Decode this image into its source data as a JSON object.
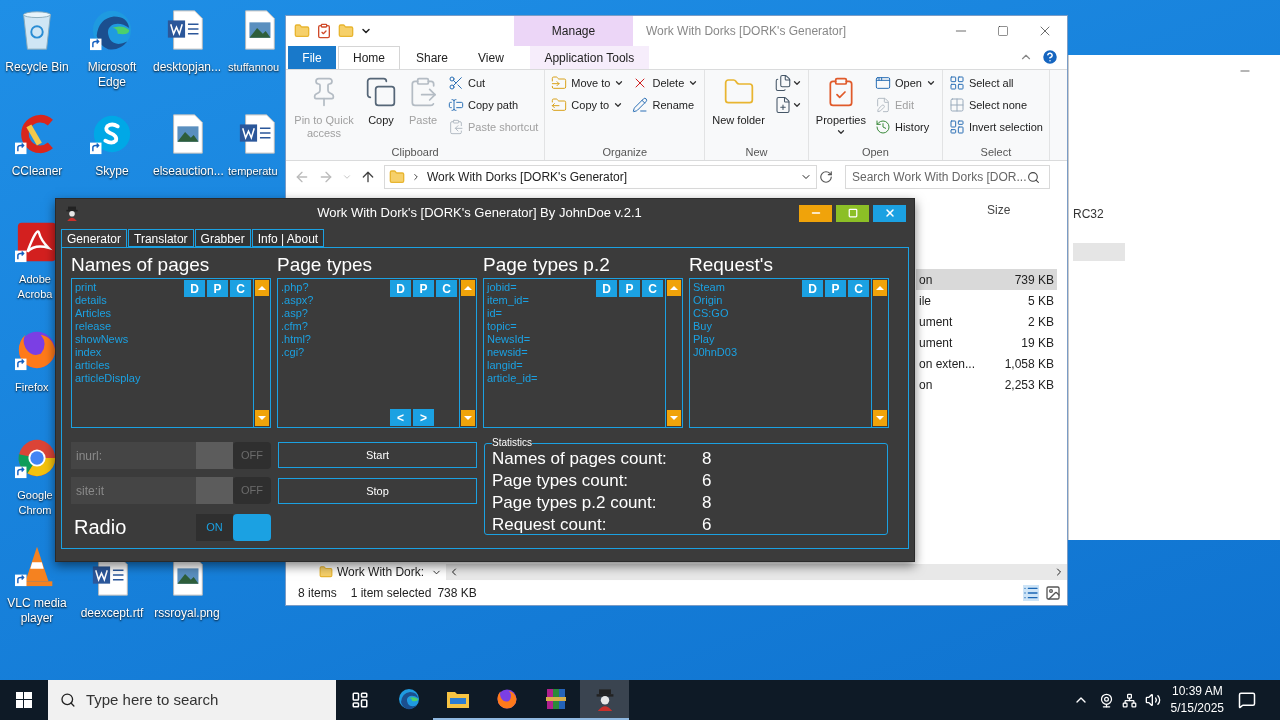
{
  "desktop_icons": [
    {
      "label": "Recycle Bin",
      "kind": "recycle",
      "shortcut": false
    },
    {
      "label": "CCleaner",
      "kind": "cleaner",
      "shortcut": true
    },
    {
      "label": "Adobe Acroba",
      "kind": "pdf",
      "shortcut": true
    },
    {
      "label": "Firefox",
      "kind": "firefox",
      "shortcut": true
    },
    {
      "label": "Google Chrom",
      "kind": "chrome",
      "shortcut": true
    },
    {
      "label": "VLC media player",
      "kind": "vlc",
      "shortcut": true
    },
    {
      "label": "Microsoft Edge",
      "kind": "edge",
      "shortcut": true
    },
    {
      "label": "Skype",
      "kind": "skype",
      "shortcut": true
    },
    {
      "label": "deexcept.rtf",
      "kind": "word",
      "shortcut": false
    },
    {
      "label": "desktopjan...",
      "kind": "word",
      "shortcut": false
    },
    {
      "label": "elseauction...",
      "kind": "image",
      "shortcut": false
    },
    {
      "label": "rssroyal.png",
      "kind": "image",
      "shortcut": false
    },
    {
      "label": "stuffannou",
      "kind": "image",
      "shortcut": false
    },
    {
      "label": "temperatu",
      "kind": "word",
      "shortcut": false
    }
  ],
  "back_window": {
    "column_header": "RC32"
  },
  "explorer": {
    "context_label": "Manage",
    "title": "Work With Dorks [DORK's Generator]",
    "tabs": [
      {
        "label": "File",
        "kind": "file",
        "selected": false
      },
      {
        "label": "Home",
        "kind": "normal",
        "selected": true
      },
      {
        "label": "Share",
        "kind": "normal",
        "selected": false
      },
      {
        "label": "View",
        "kind": "normal",
        "selected": false
      },
      {
        "label": "Application Tools",
        "kind": "context",
        "selected": false
      }
    ],
    "ribbon": [
      {
        "label": "Clipboard",
        "columns": [
          [
            {
              "label": "Pin to Quick access",
              "kind": "large",
              "disabled": true,
              "dropdown": false
            }
          ],
          [
            {
              "label": "Copy",
              "kind": "large",
              "disabled": false,
              "dropdown": false
            }
          ],
          [
            {
              "label": "Paste",
              "kind": "large",
              "disabled": true,
              "dropdown": false
            }
          ],
          [
            {
              "label": "Cut",
              "kind": "small",
              "disabled": false,
              "dropdown": false
            },
            {
              "label": "Copy path",
              "kind": "small",
              "disabled": false,
              "dropdown": false
            },
            {
              "label": "Paste shortcut",
              "kind": "small",
              "disabled": true,
              "dropdown": false
            }
          ]
        ]
      },
      {
        "label": "Organize",
        "columns": [
          [
            {
              "label": "Move to",
              "kind": "small",
              "disabled": false,
              "dropdown": true
            },
            {
              "label": "Copy to",
              "kind": "small",
              "disabled": false,
              "dropdown": true
            }
          ],
          [
            {
              "label": "Delete",
              "kind": "small",
              "disabled": false,
              "dropdown": true
            },
            {
              "label": "Rename",
              "kind": "small",
              "disabled": false,
              "dropdown": false
            }
          ]
        ]
      },
      {
        "label": "New",
        "columns": [
          [
            {
              "label": "New folder",
              "kind": "large",
              "disabled": false,
              "dropdown": false
            }
          ],
          [
            {
              "kind": "icon",
              "dropdown": true
            },
            {
              "kind": "icon",
              "dropdown": true
            }
          ]
        ]
      },
      {
        "label": "Open",
        "columns": [
          [
            {
              "label": "Properties",
              "kind": "large",
              "disabled": false,
              "dropdown": true
            }
          ],
          [
            {
              "label": "Open",
              "kind": "small",
              "disabled": false,
              "dropdown": true
            },
            {
              "label": "Edit",
              "kind": "small",
              "disabled": true,
              "dropdown": false
            },
            {
              "label": "History",
              "kind": "small",
              "disabled": false,
              "dropdown": false
            }
          ]
        ]
      },
      {
        "label": "Select",
        "columns": [
          [
            {
              "label": "Select all",
              "kind": "small",
              "disabled": false,
              "dropdown": false
            },
            {
              "label": "Select none",
              "kind": "small",
              "disabled": false,
              "dropdown": false
            },
            {
              "label": "Invert selection",
              "kind": "small",
              "disabled": false,
              "dropdown": false
            }
          ]
        ]
      }
    ],
    "address": "Work With Dorks [DORK's Generator]",
    "search_placeholder": "Search Work With Dorks [DOR...",
    "size_header": "Size",
    "rows": [
      {
        "type": "on",
        "size": "739 KB",
        "selected": true
      },
      {
        "type": "ile",
        "size": "5 KB",
        "selected": false
      },
      {
        "type": "ument",
        "size": "2 KB",
        "selected": false
      },
      {
        "type": "ument",
        "size": "19 KB",
        "selected": false
      },
      {
        "type": "on exten...",
        "size": "1,058 KB",
        "selected": false
      },
      {
        "type": "on",
        "size": "2,253 KB",
        "selected": false
      }
    ],
    "nav_item": "Work With Dork:",
    "status": {
      "count": "8 items",
      "selection": "1 item selected",
      "size": "738 KB"
    }
  },
  "dork": {
    "title": "Work With Dork's [DORK's Generator] By JohnDoe v.2.1",
    "tabs": [
      {
        "label": "Generator",
        "selected": true
      },
      {
        "label": "Translator",
        "selected": false
      },
      {
        "label": "Grabber",
        "selected": false
      },
      {
        "label": "Info | About",
        "selected": false
      }
    ],
    "lists": [
      {
        "heading": "Names of pages",
        "items": [
          "print",
          "details",
          "Articles",
          "release",
          "showNews",
          "index",
          "articles",
          "articleDisplay"
        ],
        "buttons": [
          "D",
          "P",
          "C"
        ]
      },
      {
        "heading": "Page types",
        "items": [
          ".php?",
          ".aspx?",
          ".asp?",
          ".cfm?",
          ".html?",
          ".cgi?"
        ],
        "buttons": [
          "D",
          "P",
          "C"
        ],
        "nav": [
          "<",
          ">"
        ]
      },
      {
        "heading": "Page types p.2",
        "items": [
          "jobid=",
          "item_id=",
          "id=",
          "topic=",
          "NewsId=",
          "newsid=",
          "langid=",
          "article_id="
        ],
        "buttons": [
          "D",
          "P",
          "C"
        ]
      },
      {
        "heading": "Request's",
        "items": [
          "Steam",
          "Origin",
          "CS:GO",
          "Buy",
          "Play",
          "J0hnD03"
        ],
        "buttons": [
          "D",
          "P",
          "C"
        ]
      }
    ],
    "filters": [
      {
        "placeholder": "inurl:",
        "toggle": "OFF",
        "on": false
      },
      {
        "placeholder": "site:it",
        "toggle": "OFF",
        "on": false
      }
    ],
    "radio": {
      "label": "Radio",
      "toggle": "ON",
      "on": true
    },
    "actions": [
      "Start",
      "Stop"
    ],
    "statistics": {
      "title": "Statistics",
      "rows": [
        {
          "label": "Names of pages count:",
          "value": "8"
        },
        {
          "label": "Page types count:",
          "value": "6"
        },
        {
          "label": "Page types p.2 count:",
          "value": "8"
        },
        {
          "label": "Request count:",
          "value": "6"
        }
      ]
    }
  },
  "taskbar": {
    "search_placeholder": "Type here to search",
    "apps": [
      {
        "kind": "edge",
        "running": false,
        "selected": false
      },
      {
        "kind": "folder",
        "running": true,
        "selected": false
      },
      {
        "kind": "firefox",
        "running": true,
        "selected": false
      },
      {
        "kind": "archive",
        "running": true,
        "selected": false
      },
      {
        "kind": "figure",
        "running": true,
        "selected": true
      }
    ],
    "time": "10:39 AM",
    "date": "5/15/2025"
  }
}
